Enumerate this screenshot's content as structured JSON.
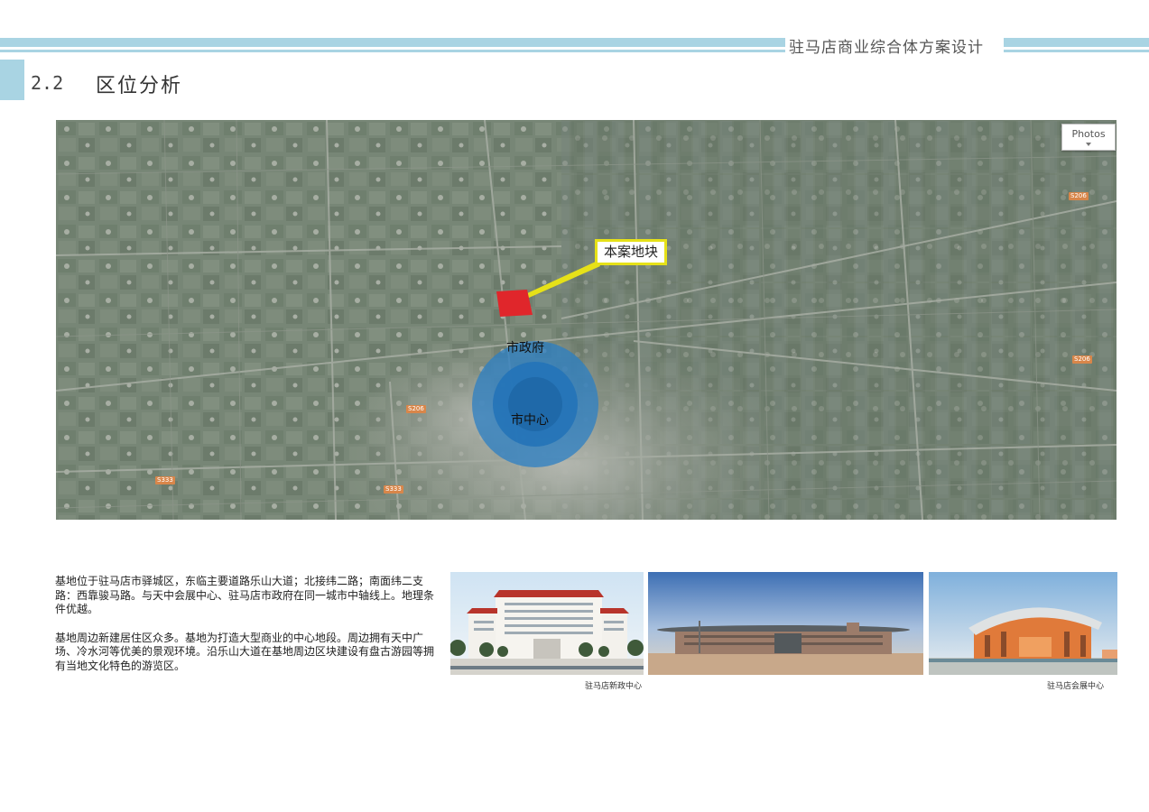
{
  "header": {
    "title": "驻马店商业综合体方案设计"
  },
  "section": {
    "number": "2.2",
    "title": "区位分析"
  },
  "map": {
    "photos_button": "Photos",
    "callout_label": "本案地块",
    "label_government": "市政府",
    "label_center": "市中心",
    "road_badges": [
      "S206",
      "S206",
      "S206",
      "S333",
      "S333"
    ],
    "colors": {
      "site": "#e0262b",
      "callout_border": "#e6e118",
      "center_circle": "#2b7fc4"
    }
  },
  "description": {
    "paragraphs": [
      "基地位于驻马店市驿城区，东临主要道路乐山大道；北接纬二路；南面纬二支路：西靠骏马路。与天中会展中心、驻马店市政府在同一城市中轴线上。地理条件优越。",
      "基地周边新建居住区众多。基地为打造大型商业的中心地段。周边拥有天中广场、冷水河等优美的景观环境。沿乐山大道在基地周边区块建设有盘古游园等拥有当地文化特色的游览区。"
    ]
  },
  "photos": {
    "caption_left": "驻马店新政中心",
    "caption_right": "驻马店会展中心"
  }
}
